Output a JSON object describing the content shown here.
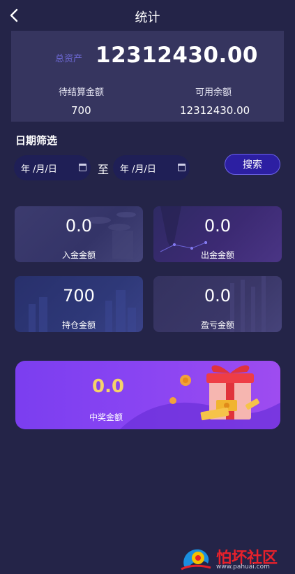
{
  "header": {
    "title": "统计"
  },
  "summary": {
    "total_label": "总资产",
    "total_value": "12312430.00",
    "pending_label": "待结算金额",
    "pending_value": "700",
    "available_label": "可用余额",
    "available_value": "12312430.00"
  },
  "filter": {
    "title": "日期筛选",
    "start_date_display": "年 /月/日",
    "separator": "至",
    "end_date_display": "年 /月/日",
    "search_label": "搜索"
  },
  "cards": [
    {
      "value": "0.0",
      "label": "入金金额"
    },
    {
      "value": "0.0",
      "label": "出金金额"
    },
    {
      "value": "700",
      "label": "持仓金额"
    },
    {
      "value": "0.0",
      "label": "盈亏金额"
    }
  ],
  "prize": {
    "value": "0.0",
    "label": "中奖金额"
  },
  "watermark": {
    "title": "怕坏社区",
    "url": "www.pahuai.com"
  },
  "colors": {
    "background": "#242448",
    "accent": "#6e69d6",
    "prize_value": "#f5d36a",
    "button": "#2c1fa2"
  }
}
